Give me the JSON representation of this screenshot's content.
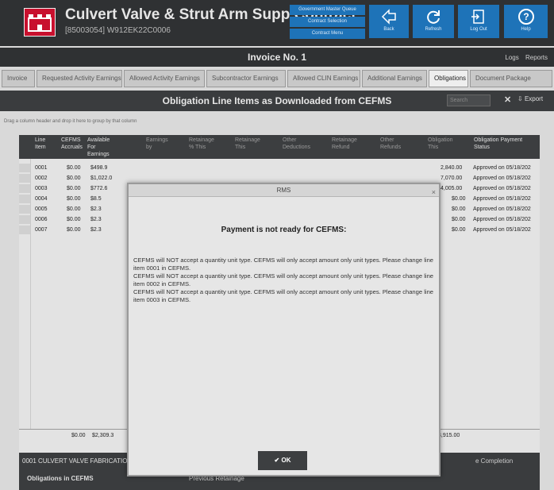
{
  "app": {
    "title": "Culvert Valve & Strut Arm Supp Contract",
    "contract_id": "[85003054] W912EK22C0006",
    "stack_buttons": [
      "Government Master Queue",
      "Contract Selection",
      "Contract Menu"
    ],
    "toolbar": {
      "back": "Back",
      "refresh": "Refresh",
      "logout": "Log Out",
      "help": "Help"
    }
  },
  "invoice_bar": {
    "title": "Invoice No. 1",
    "logs": "Logs",
    "reports": "Reports"
  },
  "tabs": [
    "Invoice",
    "Requested Activity Earnings",
    "Allowed Activity Earnings",
    "Subcontractor Earnings",
    "Allowed CLIN Earnings",
    "Additional Earnings",
    "Obligations",
    "Document Package"
  ],
  "section": {
    "title": "Obligation Line Items as Downloaded from CEFMS",
    "search_placeholder": "Search",
    "export": "Export"
  },
  "grid_hint": "Drag a column header and drop it here to group by that column",
  "grid": {
    "headers": [
      {
        "l1": "Line",
        "l2": "Item"
      },
      {
        "l1": "CEFMS",
        "l2": "Accruals"
      },
      {
        "l1": "Available",
        "l2": "For",
        "l3": "Earnings"
      },
      {
        "l1": "Earnings",
        "l2": "by"
      },
      {
        "l1": "Retainage",
        "l2": "% This"
      },
      {
        "l1": "Retainage",
        "l2": "This"
      },
      {
        "l1": "Other",
        "l2": "Deductions"
      },
      {
        "l1": "Retainage",
        "l2": "Refund"
      },
      {
        "l1": "Other",
        "l2": "Refunds"
      },
      {
        "l1": "Obligation",
        "l2": "This"
      },
      {
        "l1": "Obligation Payment",
        "l2": "Status"
      }
    ],
    "rows": [
      {
        "line": "0001",
        "accruals": "$0.00",
        "available": "$498.9",
        "obligation": "2,840.00",
        "status": "Approved on 05/18/202"
      },
      {
        "line": "0002",
        "accruals": "$0.00",
        "available": "$1,022.0",
        "obligation": "7,070.00",
        "status": "Approved on 05/18/202"
      },
      {
        "line": "0003",
        "accruals": "$0.00",
        "available": "$772.6",
        "obligation": "4,005.00",
        "status": "Approved on 05/18/202"
      },
      {
        "line": "0004",
        "accruals": "$0.00",
        "available": "$8.5",
        "obligation": "$0.00",
        "status": "Approved on 05/18/202"
      },
      {
        "line": "0005",
        "accruals": "$0.00",
        "available": "$2.3",
        "obligation": "$0.00",
        "status": "Approved on 05/18/202"
      },
      {
        "line": "0006",
        "accruals": "$0.00",
        "available": "$2.3",
        "obligation": "$0.00",
        "status": "Approved on 05/18/202"
      },
      {
        "line": "0007",
        "accruals": "$0.00",
        "available": "$2.3",
        "obligation": "$0.00",
        "status": "Approved on 05/18/202"
      }
    ],
    "footer": {
      "accruals": "$0.00",
      "available": "$2,309.3",
      "obligation": "3,915.00"
    }
  },
  "bottom": {
    "item": "0001 CULVERT VALVE FABRICATION",
    "obligations": "Obligations in CEFMS",
    "previous": "Previous Retainage",
    "completion": "e Completion"
  },
  "modal": {
    "title": "RMS",
    "close": "×",
    "heading": "Payment is not ready for CEFMS:",
    "messages": [
      "CEFMS will NOT accept a quantity unit type. CEFMS will only accept amount only unit types. Please change line item 0001 in CEFMS.",
      "CEFMS will NOT accept a quantity unit type. CEFMS will only accept amount only unit types. Please change line item 0002 in CEFMS.",
      "CEFMS will NOT accept a quantity unit type. CEFMS will only accept amount only unit types. Please change line item 0003 in CEFMS."
    ],
    "ok": "OK"
  }
}
